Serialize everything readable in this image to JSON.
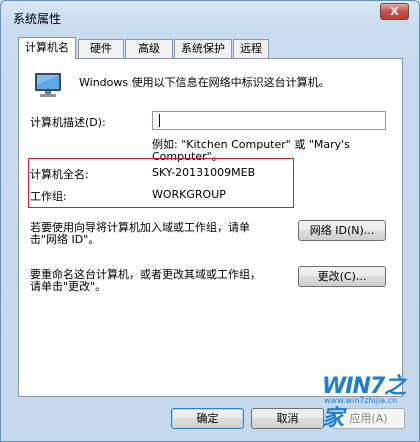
{
  "window": {
    "title": "系统属性",
    "close_label": "X"
  },
  "tabs": [
    "计算机名",
    "硬件",
    "高级",
    "系统保护",
    "远程"
  ],
  "panel": {
    "intro": "Windows 使用以下信息在网络中标识这台计算机。",
    "description_label": "计算机描述(D):",
    "description_value": "",
    "example_line1": "例如: \"Kitchen Computer\" 或 \"Mary's",
    "example_line2": "Computer\"。",
    "full_name_label": "计算机全名:",
    "full_name_value": "SKY-20131009MEB",
    "workgroup_label": "工作组:",
    "workgroup_value": "WORKGROUP",
    "network_text_line1": "若要使用向导将计算机加入域或工作组，请单",
    "network_text_line2": "击\"网络 ID\"。",
    "network_id_button": "网络 ID(N)...",
    "rename_text_line1": "要重命名这台计算机，或者更改其域或工作组，",
    "rename_text_line2": "请单击\"更改\"。",
    "change_button": "更改(C)..."
  },
  "footer": {
    "ok": "确定",
    "cancel": "取消",
    "apply": "应用(A)"
  },
  "watermark": {
    "brand": "WIN7之家",
    "url": "www.win7zhijia.cn"
  },
  "icons": {
    "computer": "computer-monitor-icon"
  },
  "colors": {
    "highlight_box": "#d02030",
    "close_button": "#c75050",
    "brand": "#1c7fd6"
  }
}
